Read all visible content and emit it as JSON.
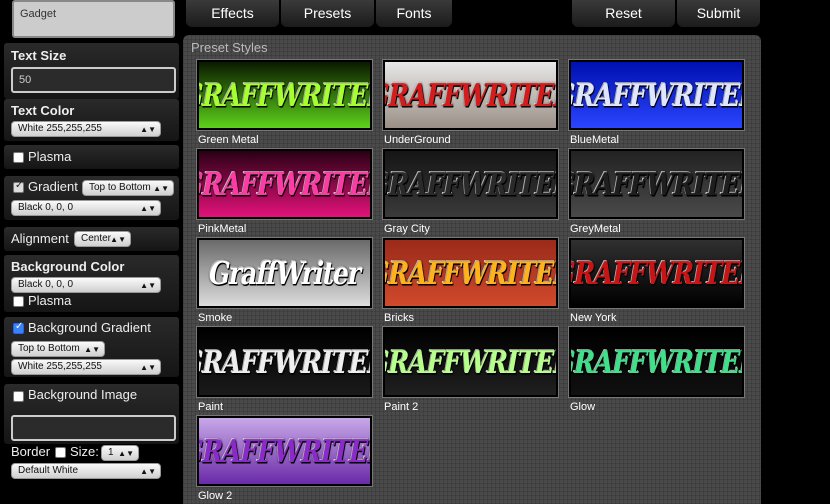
{
  "sidebar": {
    "text_value": "Gadget",
    "text_size": {
      "label": "Text Size",
      "value": "50"
    },
    "text_color": {
      "label": "Text Color",
      "value": "White 255,255,255"
    },
    "plasma": {
      "label": "Plasma",
      "checked": false
    },
    "gradient": {
      "label": "Gradient",
      "checked": true,
      "direction": "Top to Bottom",
      "color": "Black 0, 0, 0"
    },
    "alignment": {
      "label": "Alignment",
      "value": "Center"
    },
    "background_color": {
      "label": "Background Color",
      "value": "Black 0, 0, 0",
      "plasma_label": "Plasma"
    },
    "background_gradient": {
      "label": "Background Gradient",
      "checked": true,
      "direction": "Top to Bottom",
      "color": "White 255,255,255"
    },
    "background_image": {
      "label": "Background Image",
      "checked": false,
      "value": ""
    },
    "border": {
      "label": "Border",
      "size_label": "Size:",
      "size_value": "1",
      "style": "Default White"
    }
  },
  "toolbar": {
    "tabs": [
      "Effects",
      "Presets",
      "Fonts"
    ],
    "reset_label": "Reset",
    "submit_label": "Submit"
  },
  "presets": {
    "title": "Preset Styles",
    "items": [
      {
        "name": "Green Metal",
        "art_text": "GRAFFWRITER",
        "text_color": "#a6ff2e",
        "bg": "#0a1a00",
        "bg2": "#5dd21a"
      },
      {
        "name": "UnderGround",
        "art_text": "GRAFFWRITER",
        "text_color": "#d41c1c",
        "bg": "#e8e8e8",
        "bg2": "#9a8f86"
      },
      {
        "name": "BlueMetal",
        "art_text": "GRAFFWRITER",
        "text_color": "#dfe6ff",
        "bg": "#0010b0",
        "bg2": "#2a45ff"
      },
      {
        "name": "PinkMetal",
        "art_text": "GRAFFWRITER",
        "text_color": "#ff3aa6",
        "bg": "#2a0014",
        "bg2": "#e4127a"
      },
      {
        "name": "Gray City",
        "art_text": "GRAFFWRITER",
        "text_color": "#2a2a2a",
        "bg": "#151515",
        "bg2": "#3a3a3a"
      },
      {
        "name": "GreyMetal",
        "art_text": "GRAFFWRITER",
        "text_color": "#1e1e1e",
        "bg": "#222222",
        "bg2": "#4a4a4a"
      },
      {
        "name": "Smoke",
        "art_text": "GraffWriter",
        "text_color": "#ffffff",
        "bg": "#6a6a6a",
        "bg2": "#dcdcdc"
      },
      {
        "name": "Bricks",
        "art_text": "GRAFFWRITER",
        "text_color": "#ffb21a",
        "bg": "#9b2a1a",
        "bg2": "#d14a2c"
      },
      {
        "name": "New York",
        "art_text": "GRAFFWRITER",
        "text_color": "#c81414",
        "bg": "#303030",
        "bg2": "#000000"
      },
      {
        "name": "Paint",
        "art_text": "GRAFFWRITER",
        "text_color": "#eeeeee",
        "bg": "#000000",
        "bg2": "#1a1a1a"
      },
      {
        "name": "Paint 2",
        "art_text": "GRAFFWRITER",
        "text_color": "#b6ff8a",
        "bg": "#000000",
        "bg2": "#202020"
      },
      {
        "name": "Glow",
        "art_text": "GRAFFWRITER",
        "text_color": "#3ee08a",
        "bg": "#000000",
        "bg2": "#101010"
      },
      {
        "name": "Glow 2",
        "art_text": "GRAFFWRITER",
        "text_color": "#8a2ac8",
        "bg": "#c8a8e8",
        "bg2": "#6a2aa8"
      }
    ]
  }
}
